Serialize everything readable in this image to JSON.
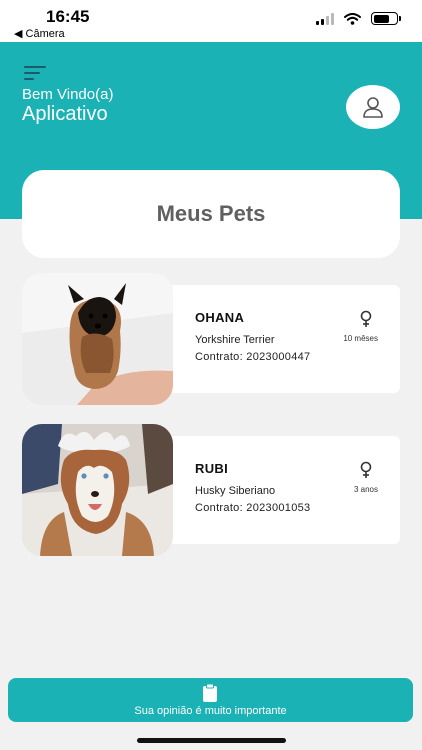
{
  "status_bar": {
    "time": "16:45",
    "back_app": "◀ Câmera",
    "icons": [
      "cellular-signal-icon",
      "wifi-icon",
      "battery-icon"
    ]
  },
  "header": {
    "menu_icon": "menu-icon",
    "welcome": "Bem Vindo(a)",
    "app_name": "Aplicativo",
    "profile_icon": "user-icon"
  },
  "section": {
    "title": "Meus Pets"
  },
  "pets": [
    {
      "name": "OHANA",
      "breed": "Yorkshire Terrier",
      "contract": "Contrato: 2023000447",
      "age": "10 mêses",
      "gender_icon": "female-icon"
    },
    {
      "name": "RUBI",
      "breed": "Husky Siberiano",
      "contract": "Contrato: 2023001053",
      "age": "3 anos",
      "gender_icon": "female-icon"
    }
  ],
  "feedback": {
    "icon": "clipboard-icon",
    "label": "Sua opinião é muito importante"
  },
  "colors": {
    "primary": "#1bb2b5",
    "background": "#f1f1f1",
    "card": "#ffffff",
    "title_text": "#606060"
  }
}
